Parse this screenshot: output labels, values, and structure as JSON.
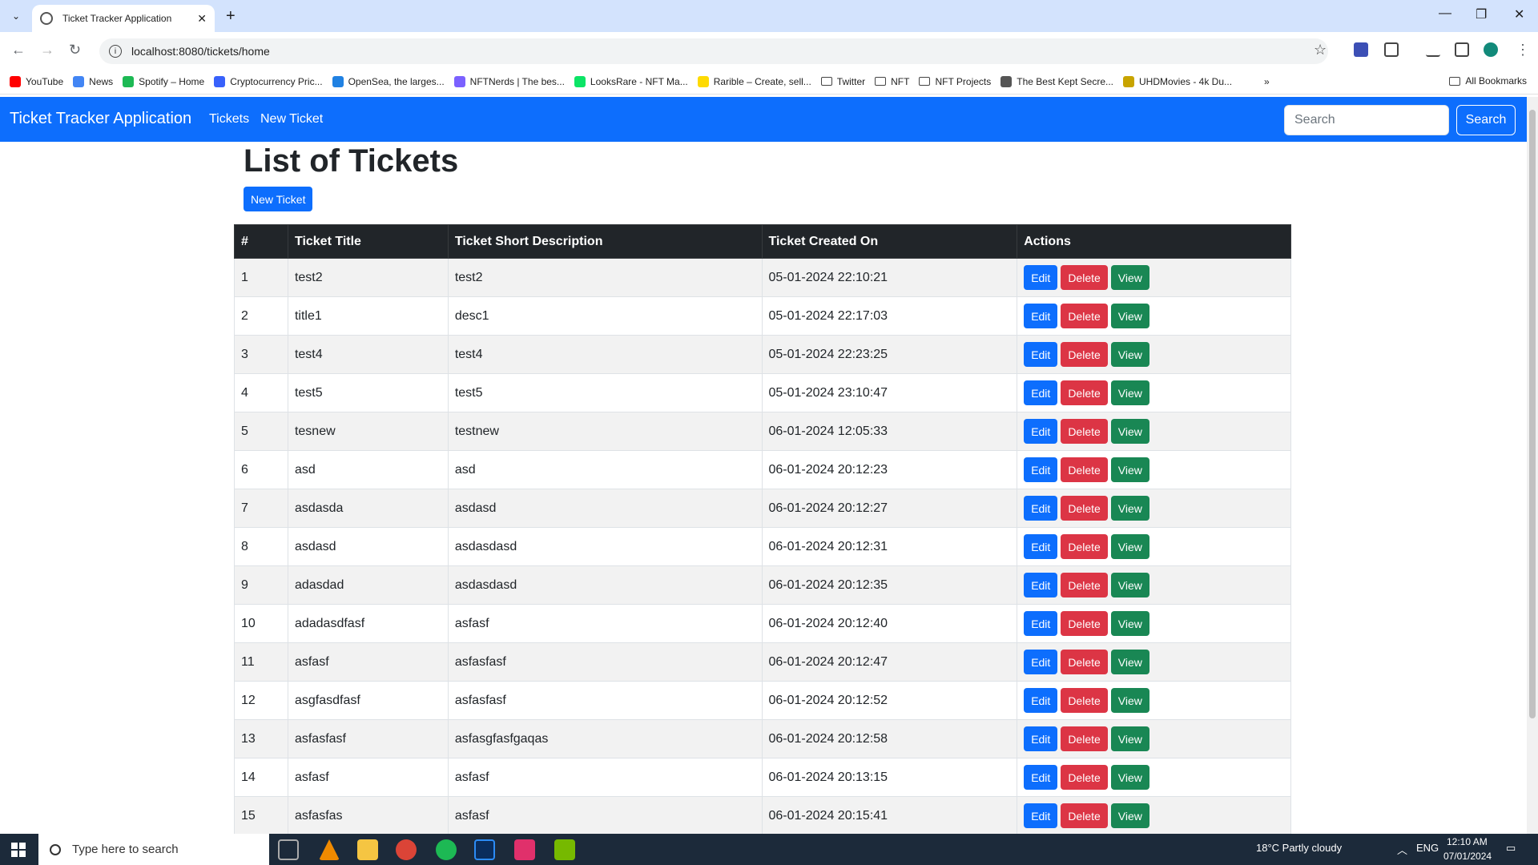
{
  "browser": {
    "tab_title": "Ticket Tracker Application",
    "url": "localhost:8080/tickets/home",
    "bookmarks": [
      {
        "label": "YouTube",
        "color": "#ff0000",
        "type": "site"
      },
      {
        "label": "News",
        "color": "#4285f4",
        "type": "site"
      },
      {
        "label": "Spotify – Home",
        "color": "#1db954",
        "type": "site"
      },
      {
        "label": "Cryptocurrency Pric...",
        "color": "#3861fb",
        "type": "site"
      },
      {
        "label": "OpenSea, the larges...",
        "color": "#2081e2",
        "type": "site"
      },
      {
        "label": "NFTNerds | The bes...",
        "color": "#7b61ff",
        "type": "site"
      },
      {
        "label": "LooksRare - NFT Ma...",
        "color": "#0ce466",
        "type": "site"
      },
      {
        "label": "Rarible – Create, sell...",
        "color": "#feda03",
        "type": "site"
      },
      {
        "label": "Twitter",
        "type": "folder"
      },
      {
        "label": "NFT",
        "type": "folder"
      },
      {
        "label": "NFT Projects",
        "type": "folder"
      },
      {
        "label": "The Best Kept Secre...",
        "color": "#555555",
        "type": "site"
      },
      {
        "label": "UHDMovies - 4k Du...",
        "color": "#c8a400",
        "type": "site"
      }
    ],
    "all_bookmarks": "All Bookmarks"
  },
  "app": {
    "brand": "Ticket Tracker Application",
    "nav": {
      "tickets": "Tickets",
      "new_ticket": "New Ticket"
    },
    "search": {
      "placeholder": "Search",
      "button": "Search"
    },
    "page_title": "List of Tickets",
    "new_ticket_button": "New Ticket",
    "table": {
      "headers": [
        "#",
        "Ticket Title",
        "Ticket Short Description",
        "Ticket Created On",
        "Actions"
      ],
      "actions": {
        "edit": "Edit",
        "delete": "Delete",
        "view": "View"
      },
      "rows": [
        {
          "id": "1",
          "title": "test2",
          "desc": "test2",
          "created": "05-01-2024 22:10:21"
        },
        {
          "id": "2",
          "title": "title1",
          "desc": "desc1",
          "created": "05-01-2024 22:17:03"
        },
        {
          "id": "3",
          "title": "test4",
          "desc": "test4",
          "created": "05-01-2024 22:23:25"
        },
        {
          "id": "4",
          "title": "test5",
          "desc": "test5",
          "created": "05-01-2024 23:10:47"
        },
        {
          "id": "5",
          "title": "tesnew",
          "desc": "testnew",
          "created": "06-01-2024 12:05:33"
        },
        {
          "id": "6",
          "title": "asd",
          "desc": "asd",
          "created": "06-01-2024 20:12:23"
        },
        {
          "id": "7",
          "title": "asdasda",
          "desc": "asdasd",
          "created": "06-01-2024 20:12:27"
        },
        {
          "id": "8",
          "title": "asdasd",
          "desc": "asdasdasd",
          "created": "06-01-2024 20:12:31"
        },
        {
          "id": "9",
          "title": "adasdad",
          "desc": "asdasdasd",
          "created": "06-01-2024 20:12:35"
        },
        {
          "id": "10",
          "title": "adadasdfasf",
          "desc": "asfasf",
          "created": "06-01-2024 20:12:40"
        },
        {
          "id": "11",
          "title": "asfasf",
          "desc": "asfasfasf",
          "created": "06-01-2024 20:12:47"
        },
        {
          "id": "12",
          "title": "asgfasdfasf",
          "desc": "asfasfasf",
          "created": "06-01-2024 20:12:52"
        },
        {
          "id": "13",
          "title": "asfasfasf",
          "desc": "asfasgfasfgaqas",
          "created": "06-01-2024 20:12:58"
        },
        {
          "id": "14",
          "title": "asfasf",
          "desc": "asfasf",
          "created": "06-01-2024 20:13:15"
        },
        {
          "id": "15",
          "title": "asfasfas",
          "desc": "asfasf",
          "created": "06-01-2024 20:15:41"
        }
      ]
    }
  },
  "taskbar": {
    "search_placeholder": "Type here to search",
    "weather": "18°C  Partly cloudy",
    "language": "ENG",
    "time": "12:10 AM",
    "date": "07/01/2024"
  }
}
